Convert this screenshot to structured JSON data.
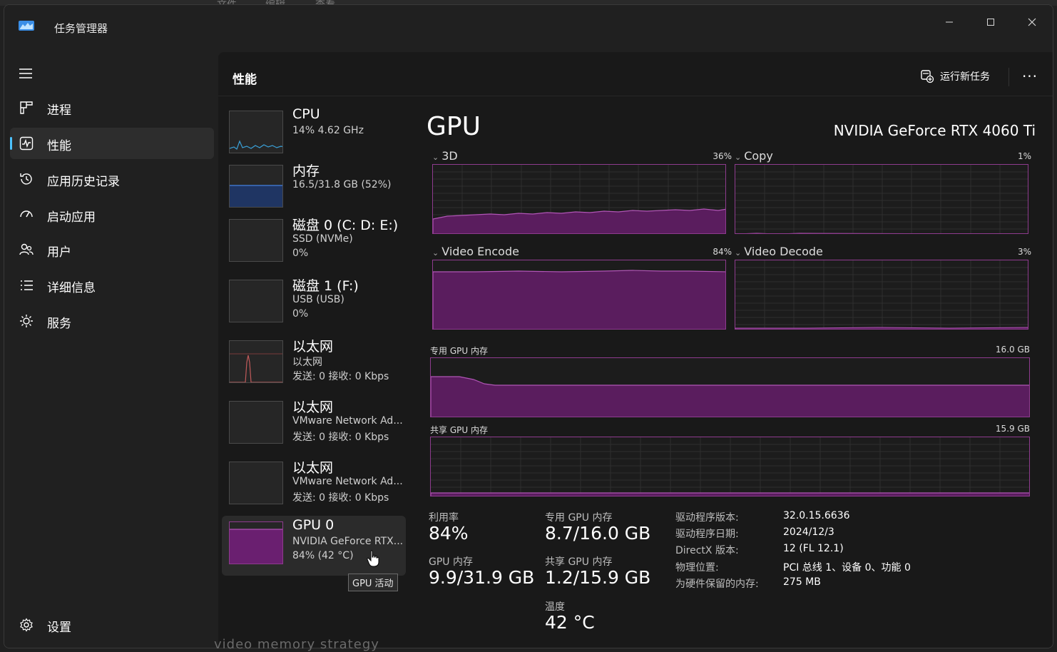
{
  "window": {
    "title": "任务管理器",
    "controls": [
      "minimize",
      "maximize",
      "close"
    ]
  },
  "background_window": {
    "menu": [
      "文件",
      "编辑",
      "查看"
    ],
    "bottom_text": "video memory strategy"
  },
  "sidebar": {
    "items": [
      {
        "label": "进程",
        "icon": "processes-icon"
      },
      {
        "label": "性能",
        "icon": "performance-icon",
        "active": true
      },
      {
        "label": "应用历史记录",
        "icon": "app-history-icon"
      },
      {
        "label": "启动应用",
        "icon": "startup-apps-icon"
      },
      {
        "label": "用户",
        "icon": "users-icon"
      },
      {
        "label": "详细信息",
        "icon": "details-icon"
      },
      {
        "label": "服务",
        "icon": "services-icon"
      }
    ],
    "settings_label": "设置"
  },
  "header": {
    "title": "性能",
    "run_task_label": "运行新任务",
    "more_label": "···"
  },
  "devices": [
    {
      "name": "CPU",
      "line2": "14%  4.62 GHz",
      "line3": "",
      "graph_color": "#3a9fd6"
    },
    {
      "name": "内存",
      "line2": "16.5/31.8 GB (52%)",
      "line3": "",
      "graph_color": "#3f73c8"
    },
    {
      "name": "磁盘 0 (C: D: E:)",
      "line2": "SSD (NVMe)",
      "line3": "0%"
    },
    {
      "name": "磁盘 1 (F:)",
      "line2": "USB (USB)",
      "line3": "0%"
    },
    {
      "name": "以太网",
      "line2": "以太网",
      "line3": "发送: 0  接收: 0 Kbps",
      "graph_color": "#c05a5a"
    },
    {
      "name": "以太网",
      "line2": "VMware Network Ad...",
      "line3": "发送: 0  接收: 0 Kbps"
    },
    {
      "name": "以太网",
      "line2": "VMware Network Ad...",
      "line3": "发送: 0  接收: 0 Kbps"
    },
    {
      "name": "GPU 0",
      "line2": "NVIDIA GeForce RTX...",
      "line3": "84% (42 °C)",
      "active": true,
      "graph_color": "#8e3b8e"
    }
  ],
  "tooltip": "GPU 活动",
  "gpu": {
    "title": "GPU",
    "model": "NVIDIA GeForce RTX 4060 Ti",
    "engines": [
      {
        "name": "3D",
        "percent": "36%"
      },
      {
        "name": "Copy",
        "percent": "1%"
      },
      {
        "name": "Video Encode",
        "percent": "84%"
      },
      {
        "name": "Video Decode",
        "percent": "3%"
      }
    ],
    "dedicated_memory_label": "专用 GPU 内存",
    "dedicated_memory_max": "16.0 GB",
    "shared_memory_label": "共享 GPU 内存",
    "shared_memory_max": "15.9 GB",
    "stats": {
      "utilization": {
        "label": "利用率",
        "value": "84%"
      },
      "dedicated": {
        "label": "专用 GPU 内存",
        "value": "8.7/16.0 GB"
      },
      "gpu_memory": {
        "label": "GPU 内存",
        "value": "9.9/31.9 GB"
      },
      "shared": {
        "label": "共享 GPU 内存",
        "value": "1.2/15.9 GB"
      },
      "temperature": {
        "label": "温度",
        "value": "42 °C"
      }
    },
    "info": [
      {
        "key": "驱动程序版本:",
        "value": "32.0.15.6636"
      },
      {
        "key": "驱动程序日期:",
        "value": "2024/12/3"
      },
      {
        "key": "DirectX 版本:",
        "value": "12 (FL 12.1)"
      },
      {
        "key": "物理位置:",
        "value": "PCI 总线 1、设备 0、功能 0"
      },
      {
        "key": "为硬件保留的内存:",
        "value": "275 MB"
      }
    ]
  },
  "colors": {
    "accent": "#4cc2ff",
    "gpu_graph": "#8e3b8e",
    "gpu_fill": "#5a1d5e"
  }
}
